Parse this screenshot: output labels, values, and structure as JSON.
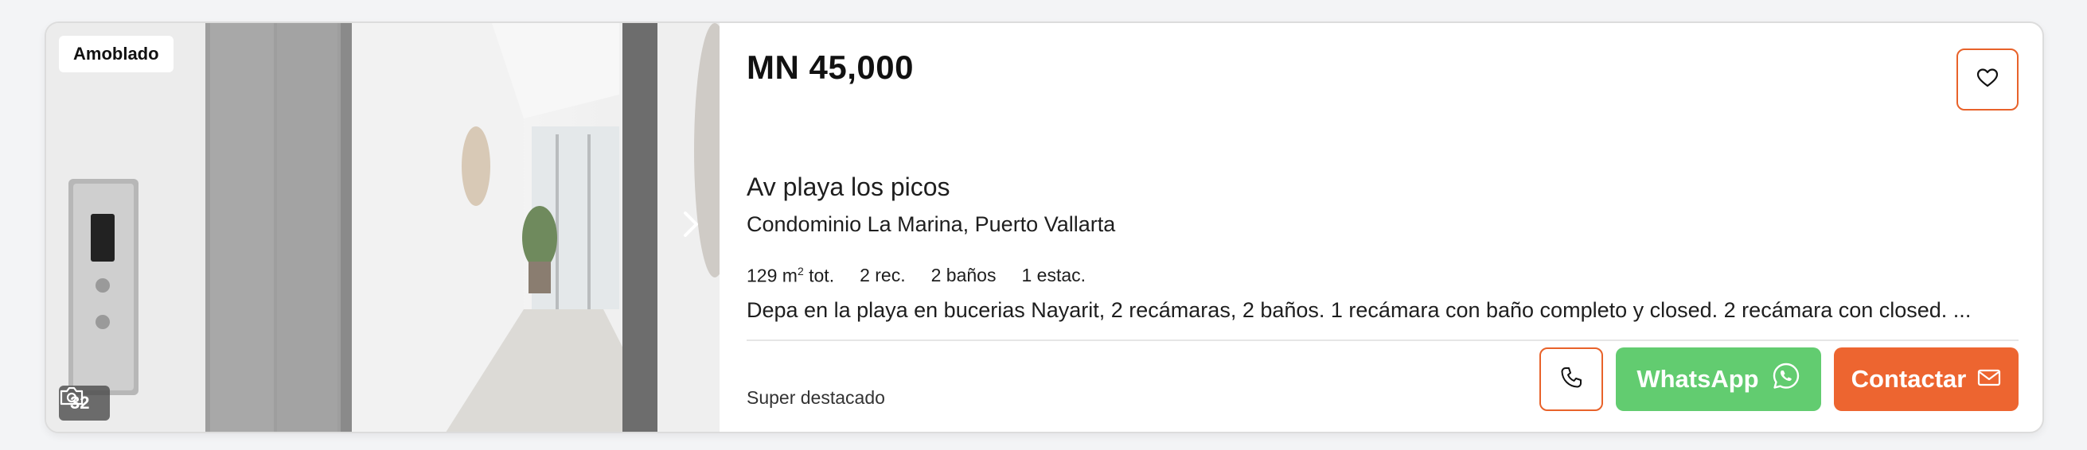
{
  "listing": {
    "badge": "Amoblado",
    "photo_count": "32",
    "price": "MN 45,000",
    "address": "Av playa los picos",
    "location": "Condominio La Marina, Puerto Vallarta",
    "features": [
      {
        "area_value": "129 m",
        "area_sup": "2",
        "area_unit": " tot."
      },
      "2 rec.",
      "2 baños",
      "1 estac."
    ],
    "description": "Depa en la playa en bucerias Nayarit, 2 recámaras, 2 baños. 1 recámara con baño completo y closed. 2 recámara con closed. ...",
    "plan": "Super destacado"
  },
  "actions": {
    "whatsapp_label": "WhatsApp",
    "contact_label": "Contactar"
  },
  "icons": {
    "favorite": "heart-icon",
    "phone": "phone-icon",
    "whatsapp": "whatsapp-icon",
    "contact": "mail-icon",
    "camera": "camera-icon",
    "next": "chevron-right-icon"
  },
  "colors": {
    "accent": "#ed6530",
    "whatsapp": "#62cc70",
    "border": "#dcdcdc"
  }
}
